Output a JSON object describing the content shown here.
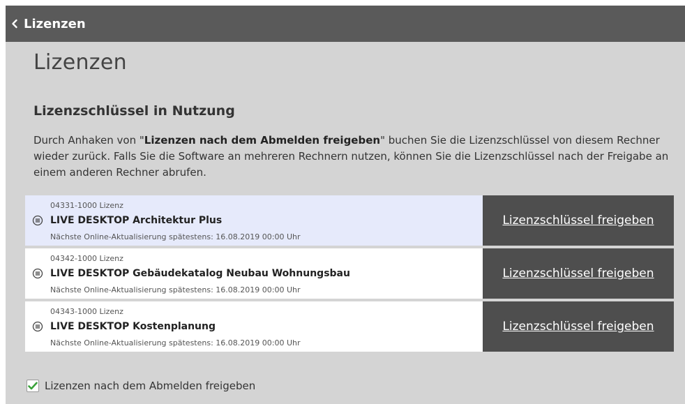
{
  "titlebar": {
    "title": "Lizenzen",
    "back_icon": "chevron-left-icon"
  },
  "page": {
    "title": "Lizenzen",
    "section_heading": "Lizenzschlüssel in Nutzung",
    "description": {
      "prefix": "Durch Anhaken von \"",
      "bold": "Lizenzen nach dem Abmelden freigeben",
      "suffix": "\" buchen Sie die Lizenzschlüssel von diesem Rechner wieder zurück. Falls Sie die Software an mehreren Rechnern nutzen, können Sie die Lizenzschlüssel nach der Freigabe an einem anderen Rechner abrufen."
    }
  },
  "licenses": [
    {
      "id": "04331-1000 Lizenz",
      "name": "LIVE DESKTOP Architektur Plus",
      "update": "Nächste Online-Aktualisierung spätestens: 16.08.2019 00:00 Uhr",
      "action": "Lizenzschlüssel freigeben",
      "selected": true
    },
    {
      "id": "04342-1000 Lizenz",
      "name": "LIVE DESKTOP Gebäudekatalog Neubau Wohnungsbau",
      "update": "Nächste Online-Aktualisierung spätestens: 16.08.2019 00:00 Uhr",
      "action": "Lizenzschlüssel freigeben",
      "selected": false
    },
    {
      "id": "04343-1000 Lizenz",
      "name": "LIVE DESKTOP Kostenplanung",
      "update": "Nächste Online-Aktualisierung spätestens: 16.08.2019 00:00 Uhr",
      "action": "Lizenzschlüssel freigeben",
      "selected": false
    }
  ],
  "release_checkbox": {
    "label": "Lizenzen nach dem Abmelden freigeben",
    "checked": true
  },
  "colors": {
    "titlebar": "#5a5a5a",
    "panel": "#d4d4d4",
    "action_button": "#4e4e4e",
    "selected_row": "#e6eafb",
    "check_green": "#3aa23a"
  }
}
